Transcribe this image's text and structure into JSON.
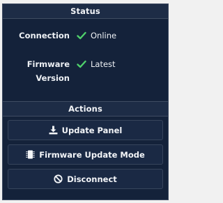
{
  "status_section": {
    "title": "Status",
    "rows": [
      {
        "label": "Connection",
        "value": "Online",
        "icon": "check-icon"
      },
      {
        "label": "Firmware Version",
        "value": "Latest",
        "icon": "check-icon"
      }
    ]
  },
  "actions_section": {
    "title": "Actions",
    "buttons": [
      {
        "label": "Update Panel",
        "icon": "download-icon"
      },
      {
        "label": "Firmware Update Mode",
        "icon": "chip-icon"
      },
      {
        "label": "Disconnect",
        "icon": "ban-icon"
      }
    ]
  },
  "colors": {
    "panel_bg": "#14223a",
    "header_bg": "#1d2c46",
    "check_green": "#4fd16b",
    "text": "#eef1f5"
  }
}
